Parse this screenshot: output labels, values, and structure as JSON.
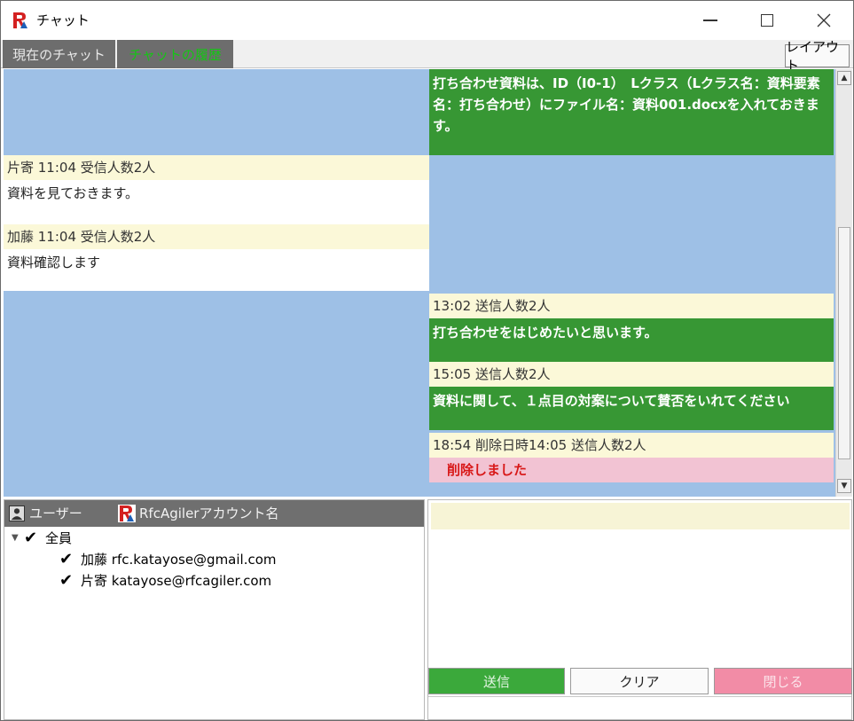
{
  "window": {
    "title": "チャット"
  },
  "tabs": {
    "current": "現在のチャット",
    "history": "チャットの履歴",
    "layout_button": "レイアウト"
  },
  "messages": {
    "sent_top": "打ち合わせ資料は、ID（I0-1）　Lクラス（Lクラス名：資料要素名：打ち合わせ）にファイル名：資料001.docxを入れておきます。",
    "recv1_meta": "片寄  11:04  受信人数2人",
    "recv1_body": "資料を見ておきます。",
    "recv2_meta": "加藤  11:04  受信人数2人",
    "recv2_body": "資料確認します",
    "sent1_meta": "13:02  送信人数2人",
    "sent1_body": "打ち合わせをはじめたいと思います。",
    "sent2_meta": "15:05  送信人数2人",
    "sent2_body": "資料に関して、１点目の対案について賛否をいれてください",
    "sent3_meta": "18:54  削除日時14:05  送信人数2人",
    "sent3_body": "削除しました"
  },
  "users": {
    "header_user": "ユーザー",
    "header_account": "RfcAgilerアカウント名",
    "all_label": "全員",
    "items": [
      {
        "name": "加藤",
        "email": "rfc.katayose@gmail.com",
        "checked": true
      },
      {
        "name": "片寄",
        "email": "katayose@rfcagiler.com",
        "checked": true
      }
    ]
  },
  "compose": {
    "input_value": "",
    "send_label": "送信",
    "clear_label": "クリア",
    "close_label": "閉じる"
  },
  "colors": {
    "chat_bg": "#9ec0e6",
    "sent_green": "#379734",
    "meta_yellow": "#fbf8d8",
    "deleted_pink": "#f2c3d3",
    "deleted_text": "#d81818"
  }
}
